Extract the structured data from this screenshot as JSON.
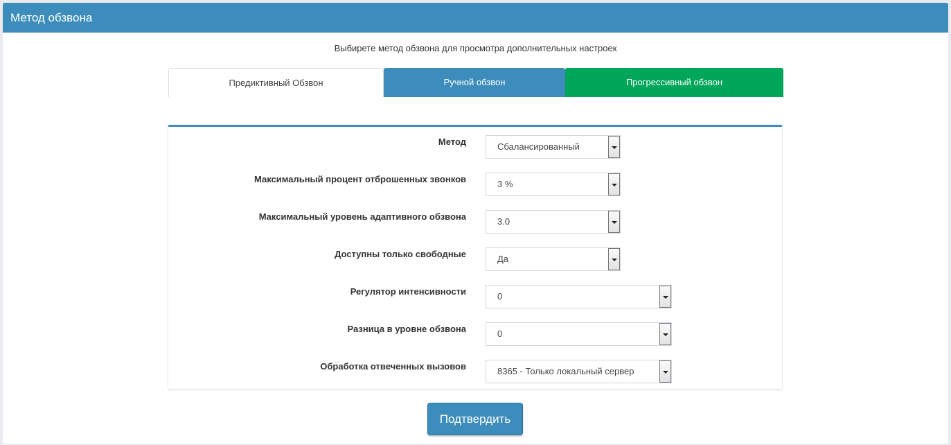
{
  "header": {
    "title": "Метод обзвона"
  },
  "hint": "Выбирете метод обзвона для просмотра дополнительных настроек",
  "tabs": [
    {
      "label": "Предиктивный Обзвон",
      "color": "#ffffff"
    },
    {
      "label": "Ручной обзвон",
      "color": "#3c8dbc"
    },
    {
      "label": "Прогрессивный обзвон",
      "color": "#00a65a"
    }
  ],
  "form": {
    "fields": [
      {
        "label": "Метод",
        "value": "Сбалансированный"
      },
      {
        "label": "Максимальный процент отброшенных звонков",
        "value": "3 %"
      },
      {
        "label": "Максимальный уровень адаптивного обзвона",
        "value": "3.0"
      },
      {
        "label": "Доступны только свободные",
        "value": "Да"
      },
      {
        "label": "Регулятор интенсивности",
        "value": "0"
      },
      {
        "label": "Разница в уровне обзвона",
        "value": "0"
      },
      {
        "label": "Обработка отвеченных вызовов",
        "value": "8365 - Только локальный сервер"
      }
    ]
  },
  "submit_label": "Подтвердить",
  "colors": {
    "primary": "#3c8dbc",
    "success": "#00a65a"
  }
}
